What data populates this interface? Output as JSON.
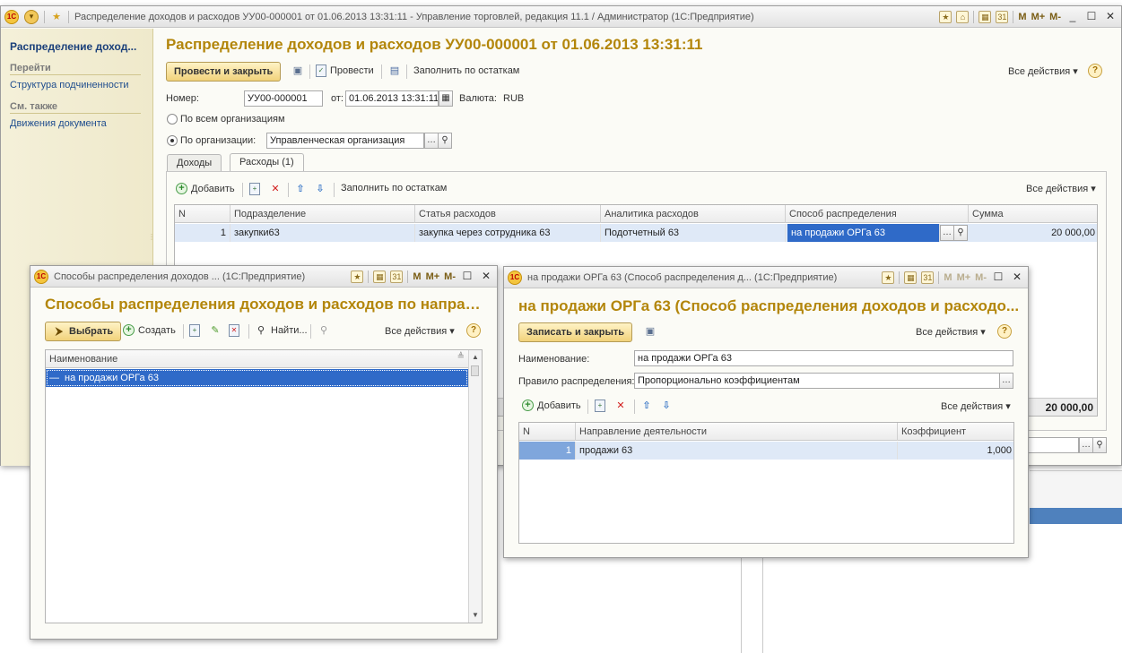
{
  "main_window": {
    "title": "Распределение доходов и расходов  УУ00-000001 от 01.06.2013 13:31:11 - Управление торговлей, редакция 11.1 / Администратор  (1С:Предприятие)",
    "tb_m": "M",
    "tb_mplus": "M+",
    "tb_mminus": "M-",
    "sidebar": {
      "current": "Распределение доход...",
      "goto_head": "Перейти",
      "goto_items": [
        "Структура подчиненности"
      ],
      "see_also_head": "См. также",
      "see_also_items": [
        "Движения документа"
      ]
    },
    "form_title": "Распределение доходов и расходов  УУ00-000001 от 01.06.2013 13:31:11",
    "toolbar": {
      "post_close": "Провести и закрыть",
      "post": "Провести",
      "fill": "Заполнить по остаткам",
      "all_actions": "Все действия ▾"
    },
    "number_label": "Номер:",
    "number_value": "УУ00-000001",
    "from_label": "от:",
    "date_value": "01.06.2013 13:31:11",
    "currency_label": "Валюта:",
    "currency_value": "RUB",
    "radio_all": "По всем организациям",
    "radio_org": "По организации:",
    "org_value": "Управленческая организация",
    "tabs": [
      "Доходы",
      "Расходы (1)"
    ],
    "table_toolbar": {
      "add": "Добавить",
      "fill": "Заполнить по остаткам",
      "all_actions": "Все действия ▾"
    },
    "columns": [
      "N",
      "Подразделение",
      "Статья расходов",
      "Аналитика расходов",
      "Способ распределения",
      "Сумма"
    ],
    "rows": [
      {
        "n": "1",
        "dept": "закупки63",
        "article": "закупка через сотрудника 63",
        "analytics": "Подотчетный 63",
        "method": "на продажи ОРГа 63",
        "sum": "20 000,00"
      }
    ],
    "total": "20 000,00"
  },
  "methods_window": {
    "title": "Способы распределения доходов ... (1С:Предприятие)",
    "tb_m": "M",
    "tb_mplus": "M+",
    "tb_mminus": "M-",
    "form_title": "Способы распределения доходов и расходов по направл...",
    "toolbar": {
      "select": "Выбрать",
      "create": "Создать",
      "find": "Найти...",
      "all_actions": "Все действия ▾"
    },
    "column": "Наименование",
    "items": [
      "на продажи ОРГа 63"
    ]
  },
  "method_window": {
    "title": "на продажи ОРГа 63 (Способ распределения д...  (1С:Предприятие)",
    "tb_m": "M",
    "tb_mplus": "M+",
    "tb_mminus": "M-",
    "form_title": "на продажи ОРГа 63 (Способ распределения доходов и расходо...",
    "toolbar": {
      "save_close": "Записать и закрыть",
      "all_actions": "Все действия ▾"
    },
    "name_label": "Наименование:",
    "name_value": "на продажи ОРГа 63",
    "rule_label": "Правило распределения:",
    "rule_value": "Пропорционально коэффициентам",
    "table_toolbar": {
      "add": "Добавить",
      "all_actions": "Все действия ▾"
    },
    "columns": [
      "N",
      "Направление деятельности",
      "Коэффициент"
    ],
    "rows": [
      {
        "n": "1",
        "direction": "продажи 63",
        "coef": "1,000"
      }
    ]
  },
  "colors": {
    "title_accent": "#b3860b",
    "selection": "#2f6ac8",
    "link": "#1f4d8e"
  }
}
